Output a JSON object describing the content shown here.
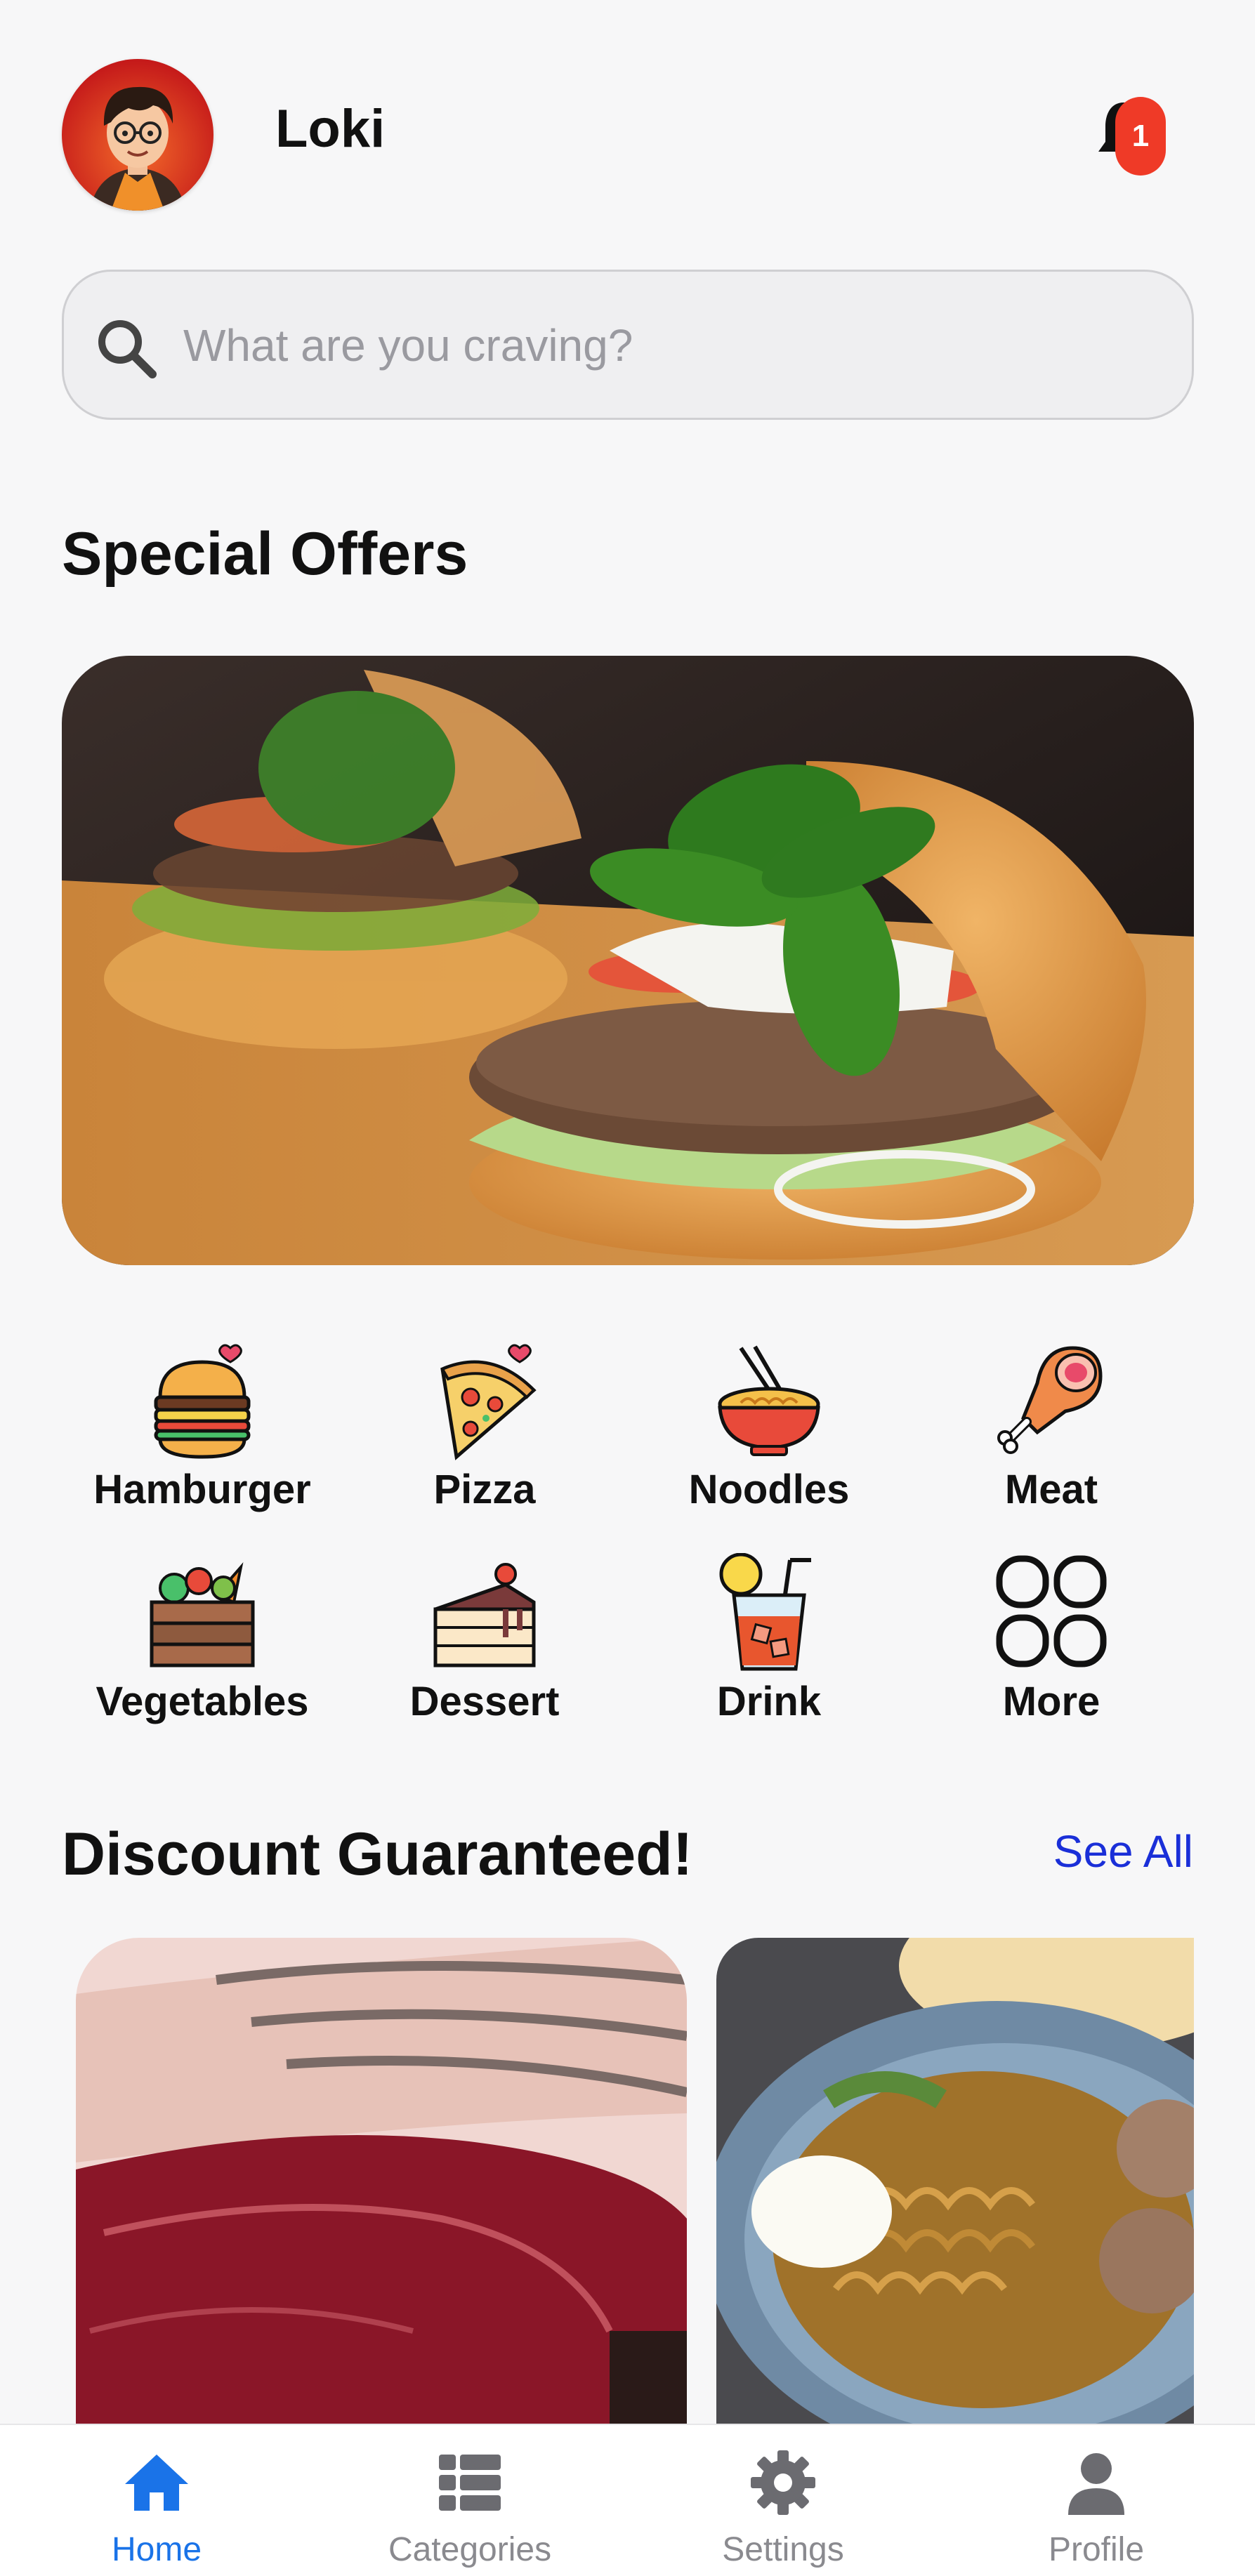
{
  "header": {
    "user_name": "Loki",
    "notification_count": "1"
  },
  "search": {
    "placeholder": "What are you craving?"
  },
  "special_offers": {
    "title": "Special Offers"
  },
  "categories": [
    {
      "label": "Hamburger",
      "icon": "hamburger-icon"
    },
    {
      "label": "Pizza",
      "icon": "pizza-icon"
    },
    {
      "label": "Noodles",
      "icon": "noodles-icon"
    },
    {
      "label": "Meat",
      "icon": "meat-icon"
    },
    {
      "label": "Vegetables",
      "icon": "vegetables-icon"
    },
    {
      "label": "Dessert",
      "icon": "dessert-icon"
    },
    {
      "label": "Drink",
      "icon": "drink-icon"
    },
    {
      "label": "More",
      "icon": "more-grid-icon"
    }
  ],
  "discount": {
    "title": "Discount Guaranteed!",
    "see_all": "See All"
  },
  "bottom_nav": [
    {
      "label": "Home",
      "icon": "home-icon",
      "active": true
    },
    {
      "label": "Categories",
      "icon": "list-icon",
      "active": false
    },
    {
      "label": "Settings",
      "icon": "gear-icon",
      "active": false
    },
    {
      "label": "Profile",
      "icon": "person-icon",
      "active": false
    }
  ],
  "colors": {
    "accent": "#1a73e8",
    "badge": "#ef3a27",
    "link": "#1a2fd8",
    "background": "#f7f7f8"
  }
}
